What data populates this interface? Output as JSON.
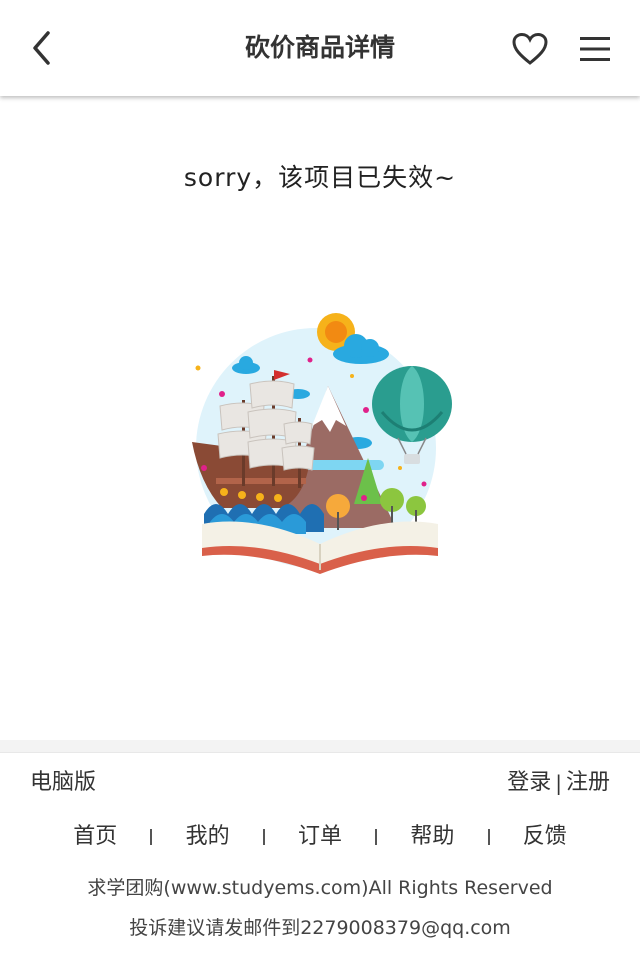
{
  "header": {
    "title": "砍价商品详情",
    "icons": {
      "back": "chevron-left-icon",
      "favorite": "heart-outline-icon",
      "menu": "hamburger-menu-icon"
    }
  },
  "main": {
    "message": "sorry，该项目已失效~",
    "illustration": "storybook-ship-balloon-illustration"
  },
  "footer": {
    "desktop_link": "电脑版",
    "login": "登录",
    "auth_separator": "|",
    "register": "注册",
    "nav": [
      "首页",
      "我的",
      "订单",
      "帮助",
      "反馈"
    ],
    "copyright": "求学团购(www.studyems.com)All Rights Reserved",
    "complaint": "投诉建议请发邮件到2279008379@qq.com"
  },
  "colors": {
    "background": "#ffffff",
    "text": "#333333",
    "footer_gap": "#f3f3f3"
  }
}
